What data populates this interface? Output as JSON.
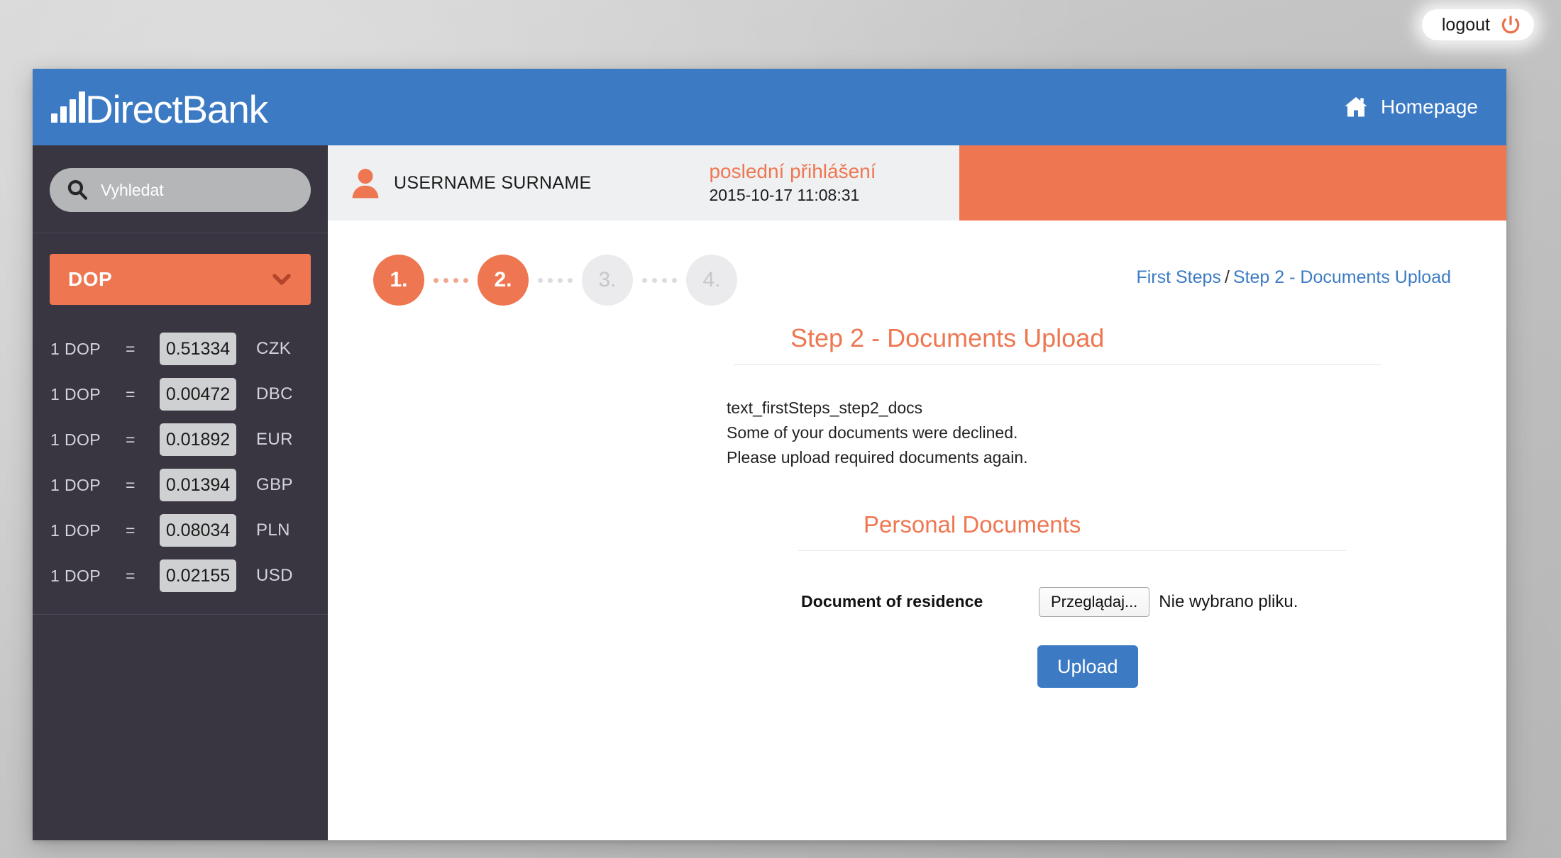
{
  "topbar": {
    "logout_label": "logout",
    "logout_icon": "power-icon"
  },
  "header": {
    "brand": "DirectBank",
    "brand_icon": "bar-chart-logo-icon",
    "home_label": "Homepage",
    "home_icon": "home-icon"
  },
  "sidebar": {
    "search": {
      "placeholder": "Vyhledat",
      "value": "",
      "icon": "search-icon"
    },
    "currency_select": {
      "selected": "DOP",
      "chevron_icon": "chevron-down-icon"
    },
    "rates": [
      {
        "from": "1 DOP",
        "eq": "=",
        "value": "0.51334",
        "currency": "CZK"
      },
      {
        "from": "1 DOP",
        "eq": "=",
        "value": "0.00472",
        "currency": "DBC"
      },
      {
        "from": "1 DOP",
        "eq": "=",
        "value": "0.01892",
        "currency": "EUR"
      },
      {
        "from": "1 DOP",
        "eq": "=",
        "value": "0.01394",
        "currency": "GBP"
      },
      {
        "from": "1 DOP",
        "eq": "=",
        "value": "0.08034",
        "currency": "PLN"
      },
      {
        "from": "1 DOP",
        "eq": "=",
        "value": "0.02155",
        "currency": "USD"
      }
    ]
  },
  "userbar": {
    "avatar_icon": "user-avatar-icon",
    "username": "USERNAME SURNAME",
    "last_login_title": "poslední přihlášení",
    "last_login_date": "2015-10-17 11:08:31"
  },
  "steps": [
    {
      "label": "1.",
      "state": "active"
    },
    {
      "label": "2.",
      "state": "active"
    },
    {
      "label": "3.",
      "state": "idle"
    },
    {
      "label": "4.",
      "state": "idle"
    }
  ],
  "breadcrumb": {
    "root": "First Steps",
    "separator": "/",
    "current": "Step 2 - Documents Upload"
  },
  "page": {
    "title": "Step 2 - Documents Upload",
    "intro_line1": "text_firstSteps_step2_docs",
    "intro_line2": "Some of your documents were declined.",
    "intro_line3": "Please upload required documents again."
  },
  "personal_documents": {
    "section_title": "Personal Documents",
    "field_label": "Document of residence",
    "file_button": "Przeglądaj...",
    "file_status": "Nie wybrano pliku.",
    "upload_button": "Upload"
  },
  "colors": {
    "accent_orange": "#ee7752",
    "brand_blue": "#3c7bc4",
    "sidebar_dark": "#393642",
    "userbar_grey": "#eff0f2",
    "step_idle": "#ebebed"
  }
}
